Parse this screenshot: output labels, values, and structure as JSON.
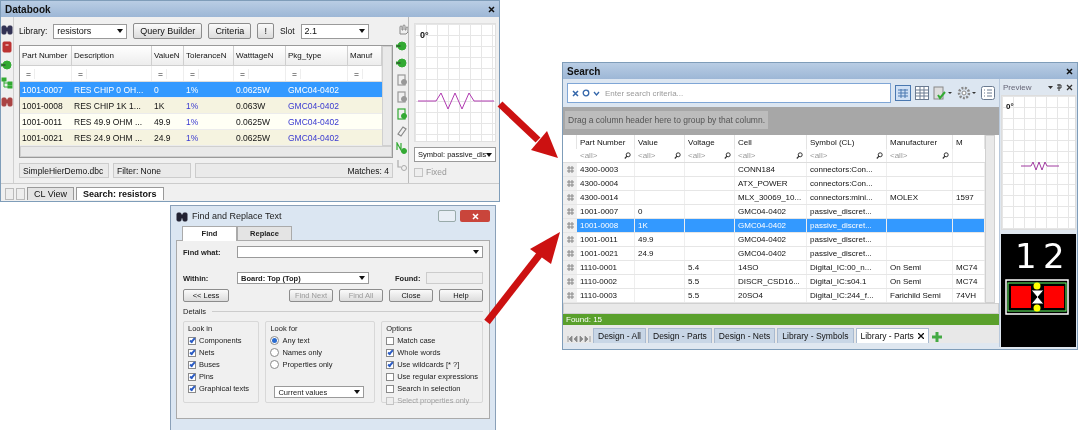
{
  "databook": {
    "title": "Databook",
    "library_label": "Library:",
    "library": "resistors",
    "buttons": [
      {
        "label": "Query Builder"
      },
      {
        "label": "Criteria"
      },
      {
        "label": "!"
      }
    ],
    "slot_label": "Slot",
    "slot": "2.1",
    "columns": [
      {
        "label": "Part Number",
        "kind": "text",
        "filter": "="
      },
      {
        "label": "Description",
        "kind": "text",
        "filter": "="
      },
      {
        "label": "ValueN",
        "kind": "text",
        "filter": "="
      },
      {
        "label": "ToleranceN",
        "kind": "link",
        "filter": "="
      },
      {
        "label": "WatttageN",
        "kind": "text",
        "filter": "="
      },
      {
        "label": "Pkg_type",
        "kind": "link",
        "filter": "="
      },
      {
        "label": "Manuf",
        "kind": "text",
        "filter": "="
      }
    ],
    "rows": [
      {
        "cells": [
          "1001-0007",
          "RES CHIP 0 OH...",
          "0",
          "1%",
          "0.0625W",
          "GMC04-0402"
        ],
        "selected": true
      },
      {
        "cells": [
          "1001-0008",
          "RES CHIP 1K 1...",
          "1K",
          "1%",
          "0.063W",
          "GMC04-0402"
        ],
        "selected": false
      },
      {
        "cells": [
          "1001-0011",
          "RES 49.9 OHM ...",
          "49.9",
          "1%",
          "0.0625W",
          "GMC04-0402"
        ],
        "selected": false
      },
      {
        "cells": [
          "1001-0021",
          "RES 24.9 OHM ...",
          "24.9",
          "1%",
          "0.0625W",
          "GMC04-0402"
        ],
        "selected": false
      }
    ],
    "file": "SimpleHierDemo.dbc",
    "filter": "Filter: None",
    "matches": "Matches: 4",
    "tabs": [
      {
        "label": "CL View",
        "selected": false
      },
      {
        "label": "Search: resistors",
        "selected": true
      }
    ],
    "preview": {
      "angle": "0°",
      "symbol": "Symbol: passive_dis",
      "fixed": {
        "label": "Fixed",
        "checked": false,
        "disabled": true
      }
    }
  },
  "find": {
    "title": "Find and Replace Text",
    "tabs": [
      {
        "label": "Find",
        "selected": true
      },
      {
        "label": "Replace",
        "selected": false
      }
    ],
    "find_what_label": "Find what:",
    "within_label": "Within:",
    "within": "Board: Top (Top)",
    "found_label": "Found:",
    "buttons": [
      {
        "label": "<< Less",
        "disabled": false
      },
      {
        "label": "Find Next",
        "disabled": true
      },
      {
        "label": "Find All",
        "disabled": true
      },
      {
        "label": "Close",
        "disabled": false
      },
      {
        "label": "Help",
        "disabled": false
      }
    ],
    "details": "Details",
    "look_in": {
      "title": "Look in",
      "items": [
        {
          "label": "Components",
          "checked": true
        },
        {
          "label": "Nets",
          "checked": true
        },
        {
          "label": "Buses",
          "checked": true
        },
        {
          "label": "Pins",
          "checked": true
        },
        {
          "label": "Graphical texts",
          "checked": true
        }
      ]
    },
    "look_for": {
      "title": "Look for",
      "items": [
        {
          "label": "Any text",
          "selected": true
        },
        {
          "label": "Names only",
          "selected": false
        },
        {
          "label": "Properties only",
          "selected": false
        }
      ],
      "values": "Current values"
    },
    "options": {
      "title": "Options",
      "items": [
        {
          "label": "Match case",
          "checked": false,
          "disabled": false
        },
        {
          "label": "Whole words",
          "checked": true,
          "disabled": false
        },
        {
          "label": "Use wildcards [* ?]",
          "checked": true,
          "disabled": false
        },
        {
          "label": "Use regular expressions",
          "checked": false,
          "disabled": false
        },
        {
          "label": "Search in selection",
          "checked": false,
          "disabled": false
        },
        {
          "label": "Select properties only",
          "checked": false,
          "disabled": true
        }
      ]
    }
  },
  "search": {
    "title": "Search",
    "placeholder": "Enter search criteria...",
    "group_hint": "Drag a column header here to group by that column.",
    "columns": [
      {
        "label": "Part Number",
        "filter_placeholder": "<all>"
      },
      {
        "label": "Value",
        "filter_placeholder": "<all>"
      },
      {
        "label": "Voltage",
        "filter_placeholder": "<all>"
      },
      {
        "label": "Cell",
        "filter_placeholder": "<all>"
      },
      {
        "label": "Symbol (CL)",
        "filter_placeholder": "<all>"
      },
      {
        "label": "Manufacturer",
        "filter_placeholder": "<all>"
      },
      {
        "label": "M"
      }
    ],
    "rows": [
      {
        "cells": [
          "4300-0003",
          null,
          null,
          "CONN184",
          "connectors:Con..."
        ],
        "selected": false
      },
      {
        "cells": [
          "4300-0004",
          null,
          null,
          "ATX_POWER",
          "connectors:Con..."
        ],
        "selected": false
      },
      {
        "cells": [
          "4300-0014",
          null,
          null,
          "MLX_30069_10...",
          "connectors:mini...",
          "MOLEX",
          "1597"
        ],
        "selected": false
      },
      {
        "cells": [
          "1001-0007",
          "0",
          null,
          "GMC04-0402",
          "passive_discret..."
        ],
        "selected": false
      },
      {
        "cells": [
          "1001-0008",
          "1K",
          null,
          "GMC04-0402",
          "passive_discret..."
        ],
        "selected": true
      },
      {
        "cells": [
          "1001-0011",
          "49.9",
          null,
          "GMC04-0402",
          "passive_discret..."
        ],
        "selected": false
      },
      {
        "cells": [
          "1001-0021",
          "24.9",
          null,
          "GMC04-0402",
          "passive_discret..."
        ],
        "selected": false
      },
      {
        "cells": [
          "1110-0001",
          null,
          "5.4",
          "14SO",
          "Digital_IC:00_n...",
          "On Semi",
          "MC74"
        ],
        "selected": false
      },
      {
        "cells": [
          "1110-0002",
          null,
          "5.5",
          "DISCR_CSD16...",
          "Digital_IC:s04.1",
          "On Semi",
          "MC74"
        ],
        "selected": false
      },
      {
        "cells": [
          "1110-0003",
          null,
          "5.5",
          "20SO4",
          "Digital_IC:244_f...",
          "Farichild Semi",
          "74VH"
        ],
        "selected": false
      }
    ],
    "found": "Found: 15",
    "tabs": [
      {
        "label": "Design - All",
        "selected": false
      },
      {
        "label": "Design - Parts",
        "selected": false
      },
      {
        "label": "Design - Nets",
        "selected": false
      },
      {
        "label": "Library - Symbols",
        "selected": false
      },
      {
        "label": "Library - Parts",
        "selected": true
      }
    ],
    "preview": {
      "title": "Preview",
      "angle": "0°",
      "pins": [
        "1",
        "2"
      ]
    }
  }
}
